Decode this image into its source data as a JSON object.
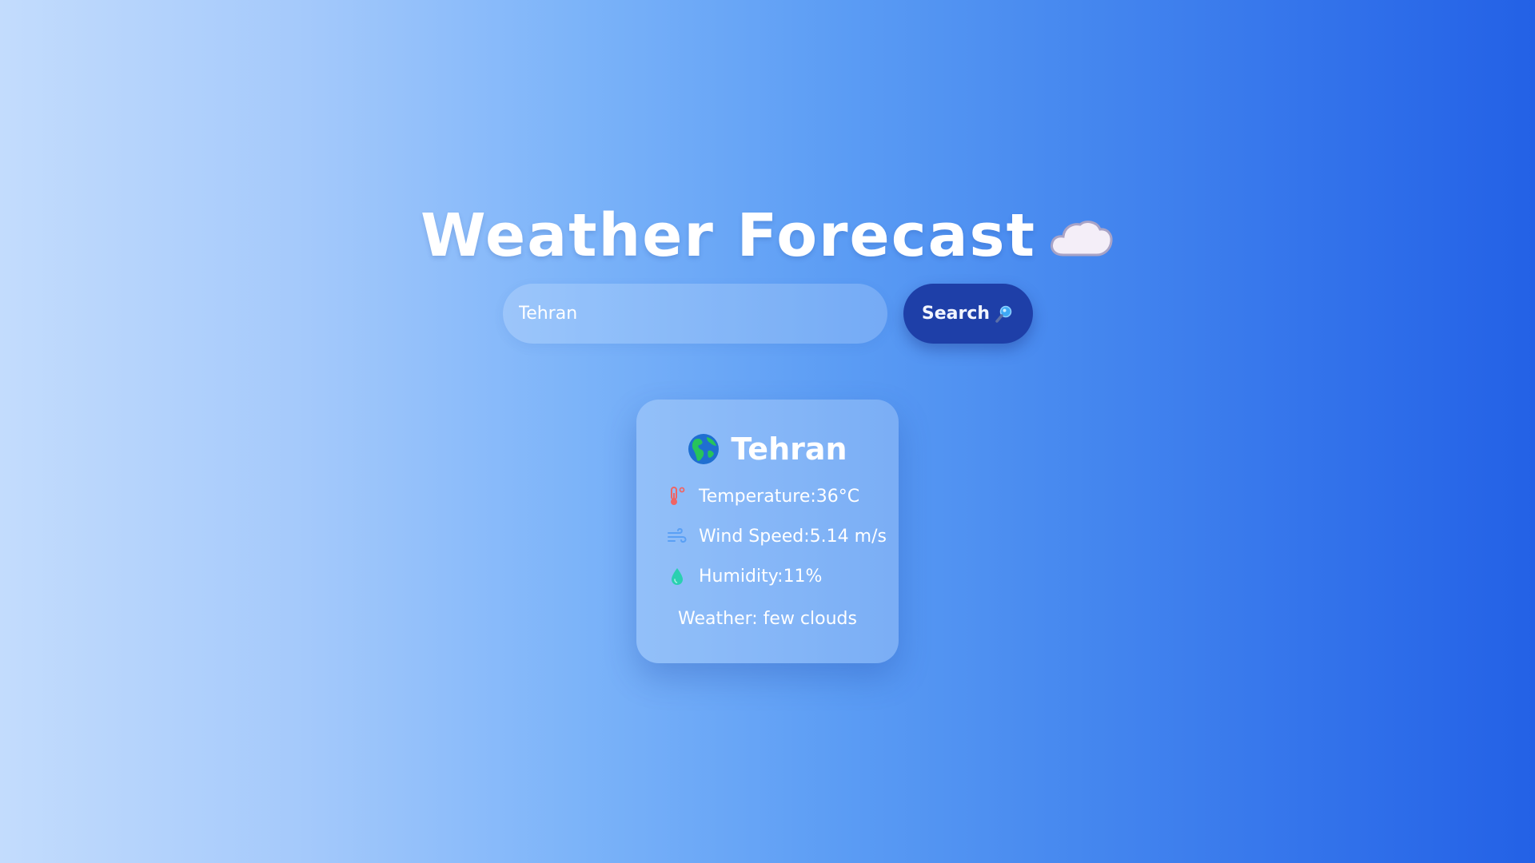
{
  "header": {
    "title": "Weather Forecast",
    "title_icon": "cloud-icon"
  },
  "search": {
    "value": "Tehran",
    "placeholder": "",
    "button_label": "Search",
    "button_icon": "magnifier-icon",
    "button_color": "#1e3fa8"
  },
  "card": {
    "city": "Tehran",
    "city_icon": "globe-icon",
    "temperature": "Temperature:36°C",
    "wind_speed": "Wind Speed:5.14 m/s",
    "humidity": "Humidity:11%",
    "weather": "Weather: few clouds"
  },
  "colors": {
    "gradient_start": "#c3dcfd",
    "gradient_end": "#2361e6",
    "temperature_icon": "#f06464",
    "wind_icon": "#5aa0f5",
    "humidity_icon": "#2ad0b0"
  }
}
